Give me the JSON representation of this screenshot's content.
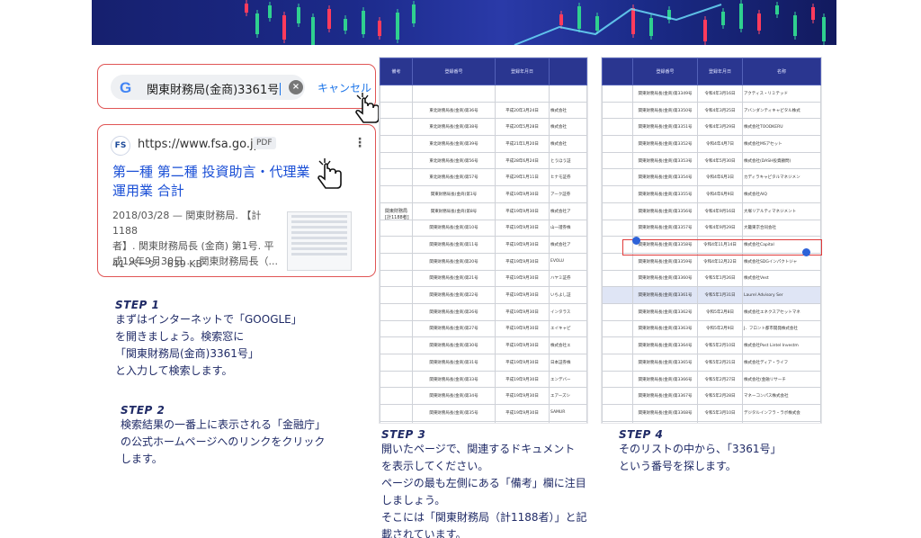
{
  "search": {
    "google_label": "G",
    "query": "関東財務局(金商)3361号",
    "clear_label": "×",
    "cancel_label": "キャンセル"
  },
  "result": {
    "favicon": "fsa-logo-icon",
    "url": "https://www.fsa.go.jp",
    "badge": "PDF",
    "more": "⋮",
    "title_line1": "第一種 第二種 投資助言・代理業",
    "title_line2": "運用業 合計",
    "snippet_line1": "2018/03/28 — 関東財務局. 【計1188",
    "snippet_line2": "者】. 関東財務局長 (金商) 第1号. 平",
    "snippet_line3": "成19年9月30日 ... 関東財務局長（...",
    "meta": "41 ページ · 639 KB"
  },
  "steps": [
    {
      "label": "STEP 1",
      "lines": [
        "まずはインターネットで「GOOGLE」",
        "を開きましょう。検索窓に",
        "「関東財務局(金商)3361号」",
        "と入力して検索します。"
      ]
    },
    {
      "label": "STEP 2",
      "lines": [
        "検索結果の一番上に表示される「金融庁」",
        "の公式ホームページへのリンクをクリック",
        "します。"
      ]
    },
    {
      "label": "STEP 3",
      "lines": [
        "開いたページで、関連するドキュメント",
        "を表示してください。",
        "ページの最も左側にある「備考」欄に注目",
        "しましょう。",
        "そこには「関東財務局（計1188者）」と記",
        "載されています。"
      ]
    },
    {
      "label": "STEP 4",
      "lines": [
        "そのリストの中から、「3361号」",
        "という番号を探します。"
      ]
    }
  ],
  "doc1": {
    "headers": [
      "備考",
      "登録番号",
      "登録年月日",
      ""
    ],
    "remark": "関東財務局\n[計1188者]",
    "rows": [
      [
        "",
        "",
        "",
        ""
      ],
      [
        "",
        "東北財務局長(金商)第36号",
        "平成20年3月24日",
        "株式会社"
      ],
      [
        "",
        "東北財務局長(金商)第38号",
        "平成20年5月28日",
        "株式会社"
      ],
      [
        "",
        "東北財務局長(金商)第39号",
        "平成21年1月20日",
        "株式会社"
      ],
      [
        "",
        "東北財務局長(金商)第56号",
        "平成28年6月24日",
        "とうほう証"
      ],
      [
        "",
        "東北財務局長(金商)第57号",
        "平成29年1月11日",
        "ヒナモ証券"
      ],
      [
        "",
        "関東財務局長(金商)第1号",
        "平成19年9月30日",
        "アーク証券"
      ],
      [
        "",
        "関東財務局長(金商)第8号",
        "平成19年9月30日",
        "株式会社ア"
      ],
      [
        "",
        "関東財務局長(金商)第10号",
        "平成19年9月30日",
        "山一證券株"
      ],
      [
        "",
        "関東財務局長(金商)第11号",
        "平成19年9月30日",
        "株式会社ア"
      ],
      [
        "",
        "関東財務局長(金商)第20号",
        "平成19年9月30日",
        "EVOLU"
      ],
      [
        "",
        "関東財務局長(金商)第21号",
        "平成19年9月30日",
        "ハヤミ証券"
      ],
      [
        "",
        "関東財務局長(金商)第22号",
        "平成19年9月30日",
        "いちよし証"
      ],
      [
        "",
        "関東財務局長(金商)第26号",
        "平成19年9月30日",
        "インタラス"
      ],
      [
        "",
        "関東財務局長(金商)第27号",
        "平成19年9月30日",
        "エイキャピ"
      ],
      [
        "",
        "関東財務局長(金商)第30号",
        "平成19年9月30日",
        "株式会社エ"
      ],
      [
        "",
        "関東財務局長(金商)第31号",
        "平成19年9月30日",
        "日本証券株"
      ],
      [
        "",
        "関東財務局長(金商)第33号",
        "平成19年9月30日",
        "エンデバー"
      ],
      [
        "",
        "関東財務局長(金商)第34号",
        "平成19年9月30日",
        "エアーズシ"
      ],
      [
        "",
        "関東財務局長(金商)第35号",
        "平成19年9月30日",
        "SAMUR"
      ],
      [
        "",
        "関東財務局長(金商)第44号",
        "平成19年9月30日",
        "スタミーン"
      ],
      [
        "",
        "関東財務局長(金商)第46号",
        "平成19年9月30日",
        "ウィフム証"
      ],
      [
        "",
        "関東財務局長(金商)第48号",
        "平成19年9月30日",
        "PWM日本"
      ],
      [
        "",
        "関東財務局長(金商)第49号",
        "平成19年9月30日",
        "キャピタル"
      ],
      [
        "",
        "関東財務局長(金商)第50号",
        "平成19年9月30日",
        "SAM証券"
      ]
    ]
  },
  "doc2": {
    "headers": [
      "",
      "登録番号",
      "登録年月日",
      "名称"
    ],
    "rows": [
      [
        "",
        "関東財務局長(金商)第3349号",
        "令和4年3月16日",
        "アクティス・リミテッド"
      ],
      [
        "",
        "関東財務局長(金商)第3350号",
        "令和4年3月25日",
        "アバンダンティキャピタル株式"
      ],
      [
        "",
        "関東財務局長(金商)第3351号",
        "令和4年3月29日",
        "株式会社TOODKERU"
      ],
      [
        "",
        "関東財務局長(金商)第3352号",
        "令和4年4月7日",
        "株式会社MSアセット"
      ],
      [
        "",
        "関東財務局長(金商)第3353号",
        "令和4年5月30日",
        "株式会社(DASH投資顧問)"
      ],
      [
        "",
        "関東財務局長(金商)第3354号",
        "令和4年6月3日",
        "カディラキャピタルマネジメン"
      ],
      [
        "",
        "関東財務局長(金商)第3355号",
        "令和4年6月9日",
        "株式会社AIQ"
      ],
      [
        "",
        "関東財務局長(金商)第3356号",
        "令和4年9月16日",
        "大塚リアルティマネジメント"
      ],
      [
        "",
        "関東財務局長(金商)第3357号",
        "令和4年9月29日",
        "大籠東京合同会社"
      ],
      [
        "",
        "関東財務局長(金商)第3358号",
        "令和4年11月14日",
        "株式会社Capital"
      ],
      [
        "",
        "関東財務局長(金商)第3359号",
        "令和4年12月22日",
        "株式会社SDGインパクトジャ"
      ],
      [
        "",
        "関東財務局長(金商)第3360号",
        "令和5年1月26日",
        "株式会社Vest"
      ],
      [
        "",
        "関東財務局長(金商)第3361号",
        "令和5年1月31日",
        "Laurel Advisory Ser"
      ],
      [
        "",
        "関東財務局長(金商)第3362号",
        "令和5年2月8日",
        "株式会社エネクスアセットマネ"
      ],
      [
        "",
        "関東財務局長(金商)第3363号",
        "令和5年2月9日",
        "J．フロント都市開発株式会社"
      ],
      [
        "",
        "関東財務局長(金商)第3364号",
        "令和5年2月10日",
        "株式会社Post Lintel Investm"
      ],
      [
        "",
        "関東財務局長(金商)第3365号",
        "令和5年2月21日",
        "株式会社ディア・ライフ"
      ],
      [
        "",
        "関東財務局長(金商)第3366号",
        "令和5年2月27日",
        "株式会社(金融リサーチ"
      ],
      [
        "",
        "関東財務局長(金商)第3367号",
        "令和5年2月28日",
        "マネーコンパス株式会社"
      ],
      [
        "",
        "関東財務局長(金商)第3368号",
        "令和5年3月10日",
        "デジタルインフラ・ラボ株式会"
      ],
      [
        "",
        "関東財務局長(金商)第3369号",
        "令和5年3月15日",
        "三菱アセットマネジメント株式"
      ],
      [
        "",
        "関東財務局長(金商)第3370号",
        "令和5年3月24日",
        "ランド・アセットマネジメント"
      ],
      [
        "",
        "関東財務局長(金商)第3371号",
        "令和5年3月30日",
        "ジャパン・エステストゥナ・イ"
      ],
      [
        "",
        "関東財務局長(金商)第3372号",
        "令和5年4月3日",
        "数理・Interグループ株式会"
      ],
      [
        "",
        "関東財務局長(金商)第3373号",
        "令和5年4月11日",
        "ブルー利益株式会社"
      ],
      [
        "",
        "関東財務局長(金商)第3374号",
        "令和5年4月18日",
        "戸田建設株式会社"
      ]
    ],
    "highlight_index": 12
  },
  "colors": {
    "accent_red": "#e05555",
    "link_blue": "#1a4fd6",
    "step_navy": "#1f2a66",
    "banner_navy": "#1c2a8a"
  }
}
